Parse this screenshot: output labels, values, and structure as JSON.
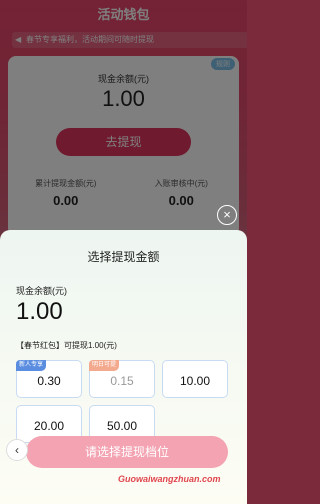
{
  "background": {
    "title": "活动钱包",
    "notice": "春节专享福利，活动期间可随时提现",
    "rule_label": "规则",
    "cash_label": "现金余额(元)",
    "cash_value": "1.00",
    "withdraw_button": "去提现",
    "stats": [
      {
        "label": "累计提现金额(元)",
        "value": "0.00"
      },
      {
        "label": "入账审核中(元)",
        "value": "0.00"
      }
    ]
  },
  "sheet": {
    "title": "选择提现金额",
    "balance_label": "现金余额(元)",
    "balance_value": "1.00",
    "coupon_line": "【春节红包】可提现1.00(元)",
    "options": [
      {
        "amount": "0.30",
        "tag": "新人专享"
      },
      {
        "amount": "0.15",
        "tag": "明日可提"
      },
      {
        "amount": "10.00",
        "tag": ""
      },
      {
        "amount": "20.00",
        "tag": ""
      },
      {
        "amount": "50.00",
        "tag": ""
      }
    ],
    "submit_button": "请选择提现档位",
    "back_icon": "‹",
    "close_icon": "×"
  },
  "watermark": "Guowaiwangzhuan.com",
  "colors": {
    "accent": "#e0355e",
    "button_disabled": "#f3a3b2",
    "option_border": "#c9dbf3"
  }
}
